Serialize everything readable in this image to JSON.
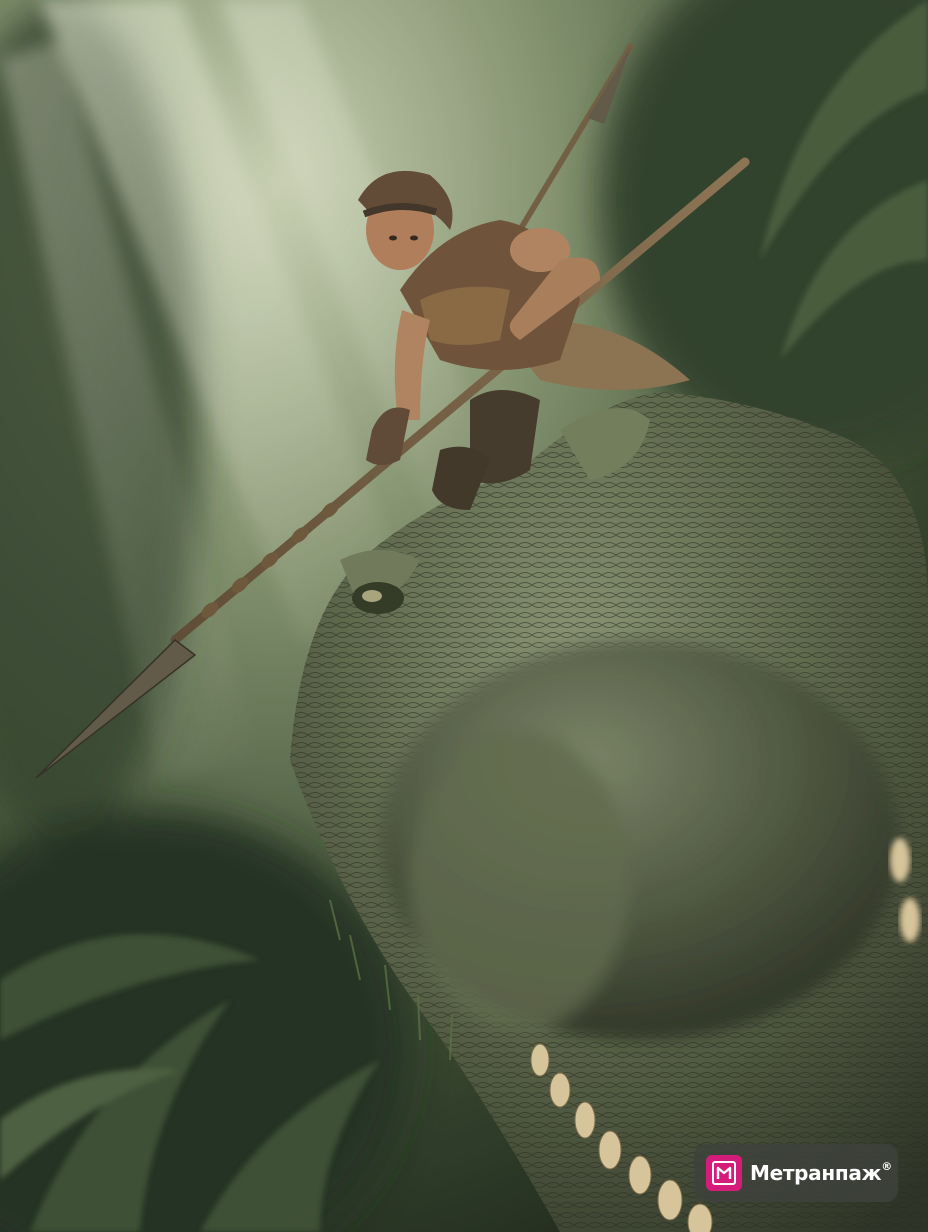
{
  "image": {
    "description_free": true,
    "palette": {
      "jungle_dark": "#1e2a1c",
      "jungle_mid": "#3f5034",
      "haze": "#b9c2a4",
      "scale_light": "#8f9978",
      "scale_dark": "#353c2b",
      "tooth": "#d8c49a",
      "skin": "#b0805c",
      "leather": "#6b4c33"
    }
  },
  "watermark": {
    "brand": "Метранпаж",
    "accent_color": "#d61c7b",
    "icon": "metranpazh-logo-icon"
  }
}
